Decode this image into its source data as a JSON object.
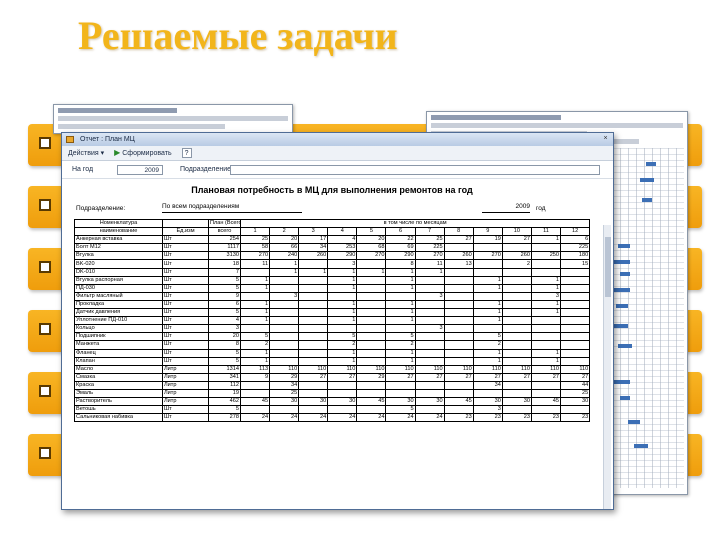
{
  "slide": {
    "title": "Решаемые задачи"
  },
  "colors": {
    "title": "#f2b51b",
    "bar": "#f5aa1a",
    "bar_mark": "#5a3a00",
    "window_border": "#4f6c95"
  },
  "window": {
    "title": "Отчет : План МЦ",
    "close_glyph": "×",
    "toolbar": {
      "actions_label": "Действия ▾",
      "form_label": "Сформировать",
      "help_label": "?"
    },
    "params": {
      "year_label": "На год",
      "year_value": "2009",
      "sub_label": "Подразделение"
    }
  },
  "report": {
    "title": "Плановая потребность в МЦ для выполнения ремонтов на год",
    "dept_label": "Подразделение:",
    "dept_value": "По всем подразделениям",
    "year_value": "2009",
    "year_suffix": "год",
    "header_top": [
      "Номенклатура",
      "",
      "План (Всего",
      "в том числе по месяцам"
    ],
    "header_bottom": [
      "наименование",
      "Ед.изм",
      "всего",
      "1",
      "2",
      "3",
      "4",
      "5",
      "6",
      "7",
      "8",
      "9",
      "10",
      "11",
      "12"
    ],
    "rows": [
      [
        "Анкерная вставка",
        "Шт",
        "254",
        "25",
        "20",
        "17",
        "4",
        "20",
        "22",
        "25",
        "27",
        "19",
        "27",
        "1",
        "6"
      ],
      [
        "Болт М12",
        "Шт",
        "1117",
        "58",
        "66",
        "34",
        "253",
        "68",
        "69",
        "225",
        "",
        "",
        "",
        "",
        "225"
      ],
      [
        "Втулка",
        "Шт",
        "3130",
        "270",
        "240",
        "260",
        "290",
        "270",
        "290",
        "270",
        "260",
        "270",
        "260",
        "250",
        "180"
      ],
      [
        "BK-020",
        "Шт",
        "18",
        "11",
        "1",
        "",
        "3",
        "",
        "8",
        "11",
        "13",
        "",
        "2",
        "",
        "15"
      ],
      [
        "DK-010",
        "Шт",
        "7",
        "",
        "1",
        "1",
        "1",
        "1",
        "1",
        "1",
        "",
        "",
        "",
        "",
        ""
      ],
      [
        "Втулка распорная",
        "Шт",
        "5",
        "1",
        "",
        "",
        "1",
        "",
        "1",
        "",
        "",
        "1",
        "",
        "1",
        ""
      ],
      [
        "ПД-030",
        "Шт",
        "5",
        "1",
        "",
        "",
        "1",
        "",
        "1",
        "",
        "",
        "1",
        "",
        "1",
        ""
      ],
      [
        "Фильтр масляный",
        "Шт",
        "9",
        "",
        "3",
        "",
        "",
        "",
        "",
        "3",
        "",
        "",
        "",
        "3",
        ""
      ],
      [
        "Прокладка",
        "Шт",
        "6",
        "1",
        "",
        "",
        "1",
        "",
        "1",
        "",
        "",
        "1",
        "",
        "1",
        ""
      ],
      [
        "Датчик давления",
        "Шт",
        "5",
        "1",
        "",
        "",
        "1",
        "",
        "1",
        "",
        "",
        "1",
        "",
        "1",
        ""
      ],
      [
        "Уплотнение ПД-010",
        "Шт",
        "4",
        "1",
        "",
        "",
        "1",
        "",
        "1",
        "",
        "",
        "1",
        "",
        "",
        ""
      ],
      [
        "Кольцо",
        "Шт",
        "3",
        "",
        "",
        "",
        "",
        "",
        "",
        "3",
        "",
        "",
        "",
        "",
        ""
      ],
      [
        "Подшипник",
        "Шт",
        "20",
        "5",
        "",
        "",
        "5",
        "",
        "5",
        "",
        "",
        "5",
        "",
        "",
        ""
      ],
      [
        "Манжета",
        "Шт",
        "8",
        "2",
        "",
        "",
        "2",
        "",
        "2",
        "",
        "",
        "2",
        "",
        "",
        ""
      ],
      [
        "Фланец",
        "Шт",
        "5",
        "1",
        "",
        "",
        "1",
        "",
        "1",
        "",
        "",
        "1",
        "",
        "1",
        ""
      ],
      [
        "Клапан",
        "Шт",
        "5",
        "1",
        "",
        "",
        "1",
        "",
        "1",
        "",
        "",
        "1",
        "",
        "1",
        ""
      ],
      [
        "Масло",
        "Литр",
        "1314",
        "113",
        "110",
        "110",
        "110",
        "110",
        "110",
        "110",
        "110",
        "110",
        "110",
        "110",
        "110"
      ],
      [
        "Смазка",
        "Литр",
        "341",
        "9",
        "29",
        "27",
        "27",
        "29",
        "27",
        "27",
        "27",
        "27",
        "27",
        "27",
        "27"
      ],
      [
        "Краска",
        "Литр",
        "112",
        "",
        "34",
        "",
        "",
        "",
        "",
        "",
        "",
        "34",
        "",
        "",
        "44"
      ],
      [
        "Эмаль",
        "Литр",
        "19",
        "",
        "25",
        "",
        "",
        "",
        "",
        "",
        "",
        "",
        "",
        "",
        "25"
      ],
      [
        "Растворитель",
        "Литр",
        "462",
        "45",
        "30",
        "30",
        "30",
        "45",
        "30",
        "30",
        "45",
        "30",
        "30",
        "45",
        "30"
      ],
      [
        "Ветошь",
        "Шт",
        "5",
        "",
        "",
        "",
        "",
        "",
        "5",
        "",
        "",
        "3",
        "",
        "",
        ""
      ],
      [
        "Сальниковая набивка",
        "Шт",
        "278",
        "24",
        "24",
        "24",
        "24",
        "24",
        "24",
        "24",
        "23",
        "23",
        "23",
        "23",
        "23"
      ]
    ]
  }
}
